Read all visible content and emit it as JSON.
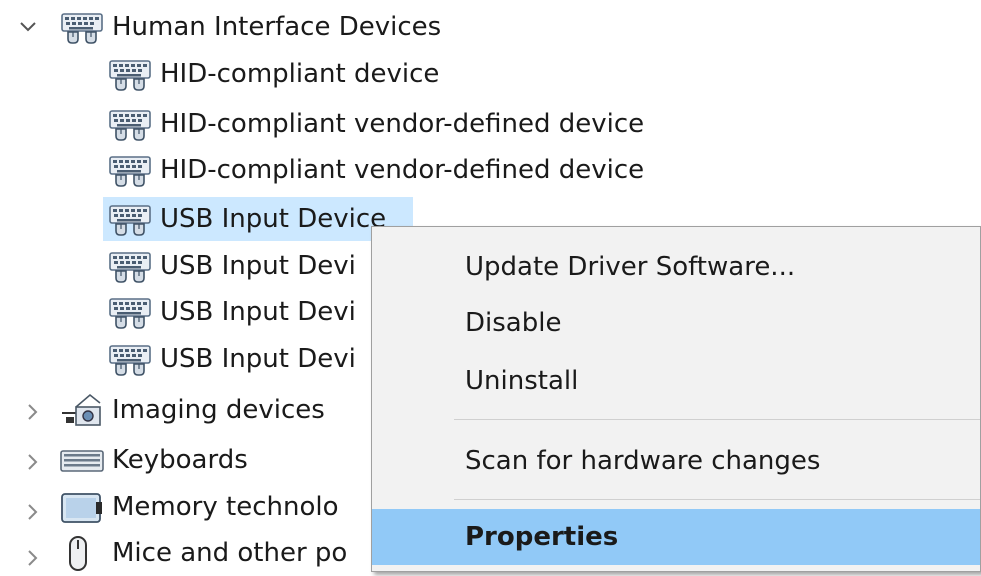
{
  "tree": {
    "category": {
      "label": "Human Interface Devices",
      "expanded": true
    },
    "children": [
      {
        "label": "HID-compliant device"
      },
      {
        "label": "HID-compliant vendor-defined device"
      },
      {
        "label": "HID-compliant vendor-defined device"
      },
      {
        "label": "USB Input Device",
        "selected": true
      },
      {
        "label": "USB Input Devi"
      },
      {
        "label": "USB Input Devi"
      },
      {
        "label": "USB Input Devi"
      }
    ],
    "collapsed": [
      {
        "label": "Imaging devices",
        "icon": "camera-icon"
      },
      {
        "label": "Keyboards",
        "icon": "keyboard-icon"
      },
      {
        "label": "Memory technolo",
        "icon": "memory-device-icon"
      },
      {
        "label": "Mice and other po",
        "icon": "mouse-icon"
      }
    ]
  },
  "context_menu": {
    "items": [
      {
        "label": "Update Driver Software..."
      },
      {
        "label": "Disable"
      },
      {
        "label": "Uninstall"
      },
      {
        "label": "Scan for hardware changes"
      },
      {
        "label": "Properties",
        "highlighted": true
      }
    ]
  },
  "colors": {
    "selection": "#cce8ff",
    "menu_highlight": "#91c9f7",
    "menu_background": "#f2f2f2"
  }
}
